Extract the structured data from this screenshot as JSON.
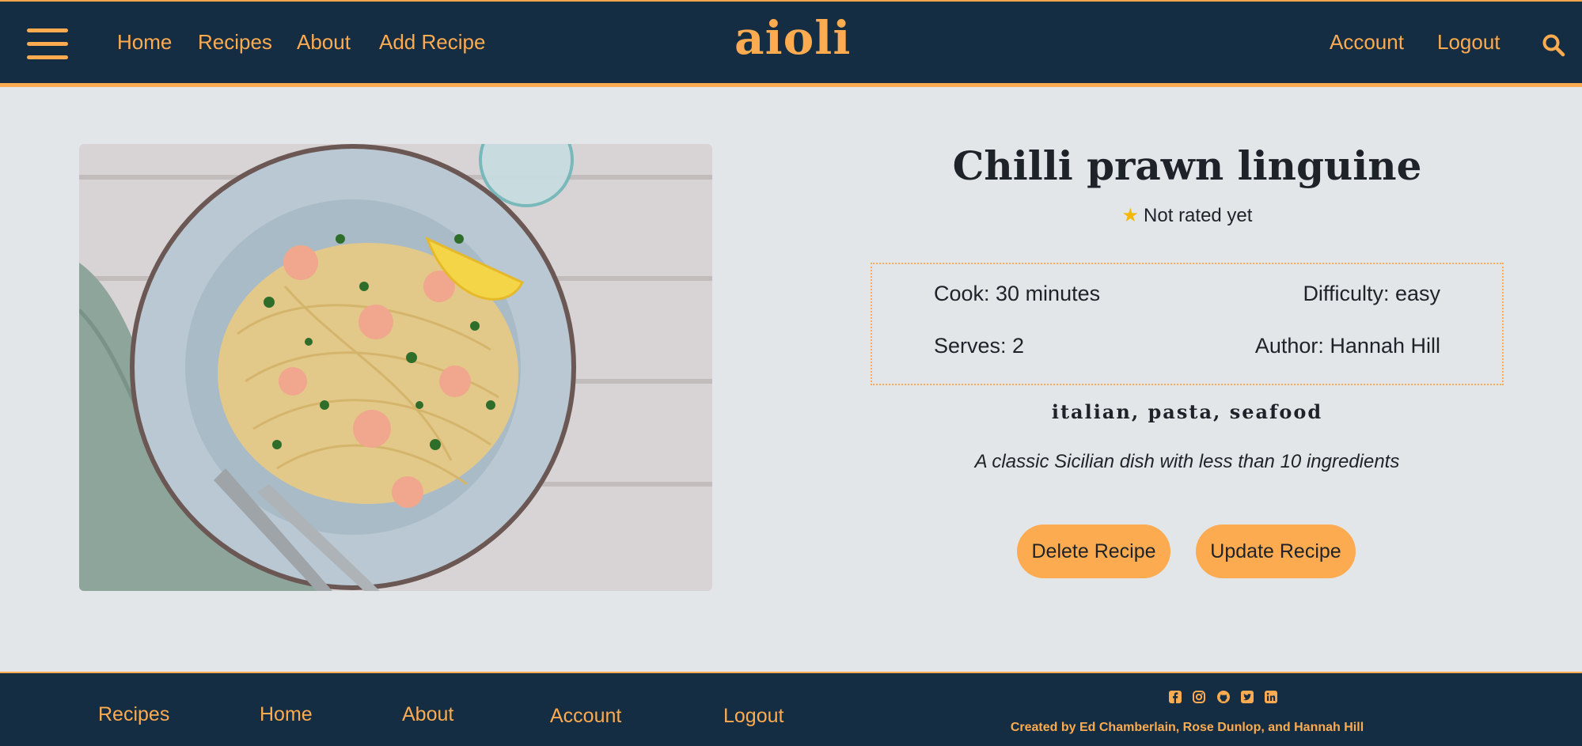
{
  "header": {
    "logo": "aioli",
    "nav_left": [
      "Home",
      "Recipes",
      "About",
      "Add Recipe"
    ],
    "nav_right": [
      "Account",
      "Logout"
    ]
  },
  "recipe": {
    "title": "Chilli prawn linguine",
    "rating": "Not rated yet",
    "cook": "Cook: 30 minutes",
    "difficulty": "Difficulty: easy",
    "serves": "Serves: 2",
    "author": "Author: Hannah Hill",
    "tags": "italian, pasta, seafood",
    "description": "A classic Sicilian dish with less than 10 ingredients",
    "delete_label": "Delete Recipe",
    "update_label": "Update Recipe"
  },
  "footer": {
    "links": [
      "Recipes",
      "Home",
      "About",
      "Account",
      "Logout"
    ],
    "social_icons": [
      "facebook-icon",
      "instagram-icon",
      "github-icon",
      "twitter-icon",
      "linkedin-icon"
    ],
    "credit": "Created by Ed Chamberlain, Rose Dunlop, and Hannah Hill"
  },
  "colors": {
    "navy": "#152d43",
    "accent": "#fcab50",
    "background": "#e3e6e9"
  }
}
